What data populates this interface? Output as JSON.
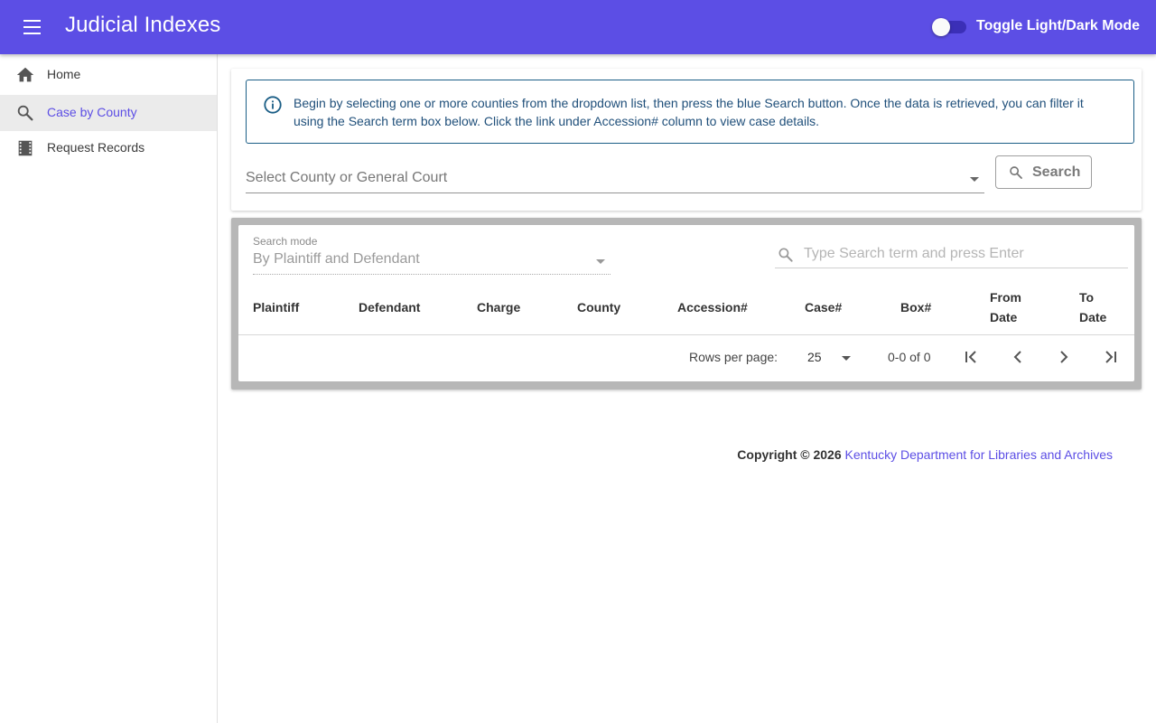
{
  "appbar": {
    "title": "Judicial Indexes",
    "toggle_label": "Toggle Light/Dark Mode"
  },
  "sidebar": {
    "items": [
      {
        "label": "Home",
        "icon": "home-icon"
      },
      {
        "label": "Case by County",
        "icon": "search-icon",
        "active": true
      },
      {
        "label": "Request Records",
        "icon": "film-strip-icon"
      }
    ]
  },
  "info": {
    "text": "Begin by selecting one or more counties from the dropdown list, then press the blue Search button. Once the data is retrieved, you can filter it using the Search term box below. Click the link under Accession# column to view case details."
  },
  "county_select": {
    "placeholder": "Select County or General Court"
  },
  "search_button": {
    "label": "Search"
  },
  "table": {
    "search_mode_label": "Search mode",
    "search_mode_value": "By Plaintiff and Defendant",
    "term_placeholder": "Type Search term and press Enter",
    "columns": [
      "Plaintiff",
      "Defendant",
      "Charge",
      "County",
      "Accession#",
      "Case#",
      "Box#",
      "From Date",
      "To Date"
    ],
    "rows": []
  },
  "pagination": {
    "rows_per_page_label": "Rows per page:",
    "rows_per_page": "25",
    "range": "0-0 of 0"
  },
  "footer": {
    "copyright": "Copyright © 2026",
    "org": "Kentucky Department for Libraries and Archives"
  },
  "colors": {
    "primary": "#5c4ee5",
    "info_border": "#1b5e86",
    "info_text": "#1f4f7a"
  }
}
